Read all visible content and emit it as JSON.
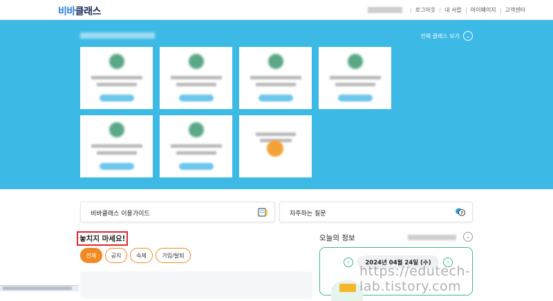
{
  "header": {
    "logo_part1": "비바",
    "logo_part2": "클래스",
    "nav": [
      "로그아웃",
      "내 서랍",
      "마이페이지",
      "고객센터"
    ]
  },
  "hero": {
    "all_classes_label": "전체 클래스 보기",
    "all_classes_icon": "chevron-down-icon",
    "background_color": "#3db9e6"
  },
  "guides": {
    "usage_guide": "비바클래스 이용가이드",
    "faq": "자주하는 질문"
  },
  "notices": {
    "title": "놓치지 마세요!",
    "filters": [
      "전체",
      "공지",
      "숙제",
      "가입/탈퇴"
    ],
    "active_filter": "전체",
    "accent_color": "#f08a24"
  },
  "today": {
    "title": "오늘의 정보",
    "date": "2024년 04월 24일 (수)",
    "accent_color": "#3aba8a"
  },
  "watermark": "https://edutech-lab.tistory.com"
}
